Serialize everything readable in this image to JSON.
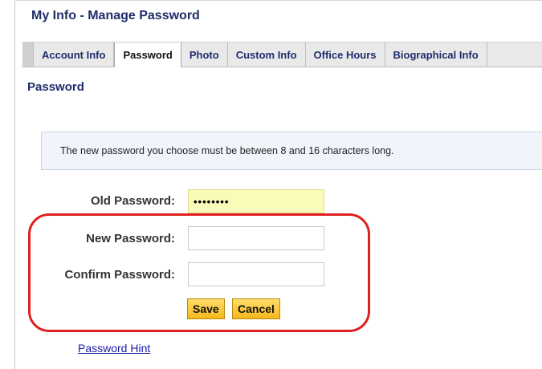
{
  "page": {
    "title": "My Info - Manage Password"
  },
  "tabs": [
    {
      "label": "Account Info",
      "active": false
    },
    {
      "label": "Password",
      "active": true
    },
    {
      "label": "Photo",
      "active": false
    },
    {
      "label": "Custom Info",
      "active": false
    },
    {
      "label": "Office Hours",
      "active": false
    },
    {
      "label": "Biographical Info",
      "active": false
    }
  ],
  "section": {
    "title": "Password"
  },
  "info": {
    "message": "The new password you choose must be between 8 and 16 characters long."
  },
  "form": {
    "old_password": {
      "label": "Old Password:",
      "value": "••••••••"
    },
    "new_password": {
      "label": "New Password:",
      "value": ""
    },
    "confirm_password": {
      "label": "Confirm Password:",
      "value": ""
    },
    "save_label": "Save",
    "cancel_label": "Cancel"
  },
  "links": {
    "password_hint": "Password Hint"
  },
  "colors": {
    "title_navy": "#1f2d6b",
    "button_gold": "#f5b81c",
    "highlight_red": "#e02020",
    "filled_field_yellow": "#fbfbb9"
  }
}
